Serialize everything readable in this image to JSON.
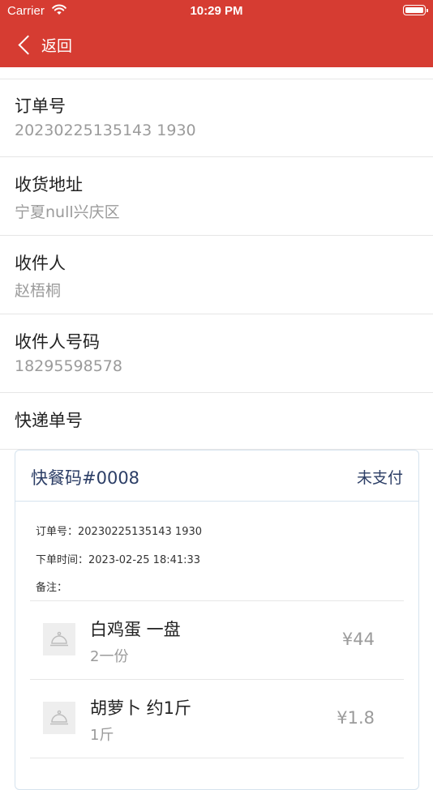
{
  "status_bar": {
    "carrier": "Carrier",
    "time": "10:29 PM"
  },
  "nav": {
    "back_label": "返回",
    "bg_color": "#d63c32"
  },
  "fields": [
    {
      "label": "订单号",
      "value": "20230225135143 1930"
    },
    {
      "label": "收货地址",
      "value": "宁夏null兴庆区"
    },
    {
      "label": "收件人",
      "value": "赵梧桐"
    },
    {
      "label": "收件人号码",
      "value": "18295598578"
    },
    {
      "label": "快递单号",
      "value": ""
    }
  ],
  "order_card": {
    "meal_code": "快餐码#0008",
    "pay_status": "未支付",
    "order_no_line": "订单号：20230225135143 1930",
    "order_time_line": "下单时间：2023-02-25 18:41:33",
    "remark_line": "备注：",
    "items": [
      {
        "name": "白鸡蛋 一盘",
        "spec": "2一份",
        "price": "¥44",
        "icon": "bell-icon"
      },
      {
        "name": "胡萝卜 约1斤",
        "spec": "1斤",
        "price": "¥1.8",
        "icon": "bell-icon"
      }
    ]
  }
}
